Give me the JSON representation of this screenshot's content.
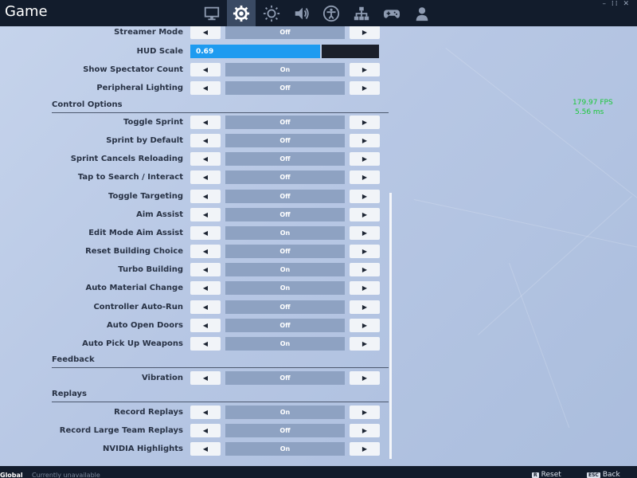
{
  "app": {
    "title": "Game"
  },
  "tabs": [
    {
      "name": "display-icon"
    },
    {
      "name": "gear-icon",
      "active": true
    },
    {
      "name": "brightness-icon"
    },
    {
      "name": "speaker-icon"
    },
    {
      "name": "accessibility-icon"
    },
    {
      "name": "network-icon"
    },
    {
      "name": "controller-icon"
    },
    {
      "name": "account-icon"
    }
  ],
  "settings": {
    "partial_row": {
      "label": "Streamer Mode",
      "value": "Off"
    },
    "hud_scale": {
      "label": "HUD Scale",
      "value": "0.69",
      "fraction": 0.69
    },
    "rows_top": [
      {
        "label": "Show Spectator Count",
        "value": "On"
      },
      {
        "label": "Peripheral Lighting",
        "value": "Off"
      }
    ],
    "control_options": {
      "title": "Control Options",
      "rows": [
        {
          "label": "Toggle Sprint",
          "value": "Off"
        },
        {
          "label": "Sprint by Default",
          "value": "Off"
        },
        {
          "label": "Sprint Cancels Reloading",
          "value": "Off"
        },
        {
          "label": "Tap to Search / Interact",
          "value": "Off"
        },
        {
          "label": "Toggle Targeting",
          "value": "Off"
        },
        {
          "label": "Aim Assist",
          "value": "Off"
        },
        {
          "label": "Edit Mode Aim Assist",
          "value": "On"
        },
        {
          "label": "Reset Building Choice",
          "value": "Off"
        },
        {
          "label": "Turbo Building",
          "value": "On"
        },
        {
          "label": "Auto Material Change",
          "value": "On"
        },
        {
          "label": "Controller Auto-Run",
          "value": "Off"
        },
        {
          "label": "Auto Open Doors",
          "value": "Off"
        },
        {
          "label": "Auto Pick Up Weapons",
          "value": "On"
        }
      ]
    },
    "feedback": {
      "title": "Feedback",
      "rows": [
        {
          "label": "Vibration",
          "value": "Off"
        }
      ]
    },
    "replays": {
      "title": "Replays",
      "rows": [
        {
          "label": "Record Replays",
          "value": "On"
        },
        {
          "label": "Record Large Team Replays",
          "value": "Off"
        },
        {
          "label": "NVIDIA Highlights",
          "value": "On"
        }
      ]
    }
  },
  "fps_overlay": {
    "fps": "179.97 FPS",
    "ms": "5.56 ms",
    "color": "#19c838"
  },
  "bottom": {
    "global": "Global",
    "status": "Currently unavailable",
    "reset": {
      "key": "R",
      "label": "Reset"
    },
    "back": {
      "key": "ESC",
      "label": "Back"
    }
  }
}
